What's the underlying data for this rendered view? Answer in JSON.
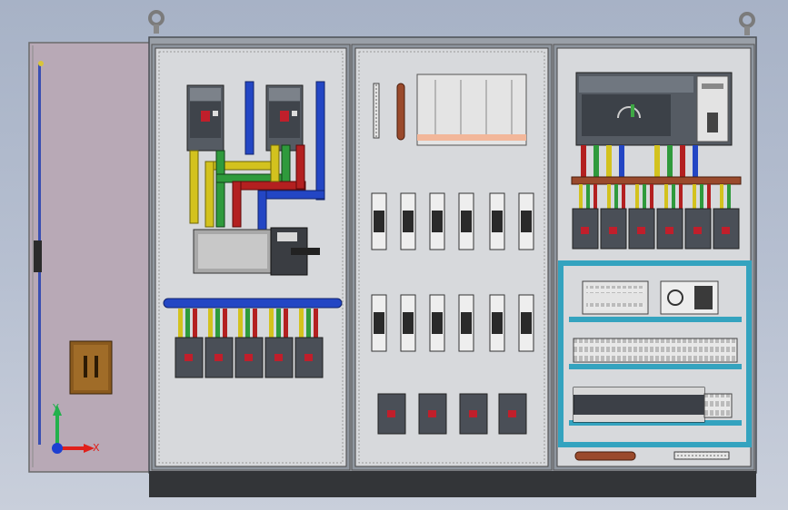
{
  "viewport": {
    "background_top": "#a7b2c6",
    "background_bottom": "#c9cfdb"
  },
  "triad": {
    "x_label": "X",
    "y_label": "Y",
    "x_color": "#e0201b",
    "y_color": "#22b14c",
    "z_color": "#1d3fd1"
  },
  "cabinet": {
    "frame_color": "#8f969f",
    "plate_color": "#d7d9dc",
    "door_color": "#b8a9b6",
    "plinth_color": "#333538"
  },
  "busbar_colors": {
    "phase_a": "#d3c21e",
    "phase_b": "#2f9a3c",
    "phase_c": "#b32020",
    "neutral": "#2346c4",
    "ground_bar": "#9a4a2c"
  },
  "icons": {
    "lifting_eye": "lifting-eye-icon",
    "door_handle": "door-handle-icon"
  }
}
